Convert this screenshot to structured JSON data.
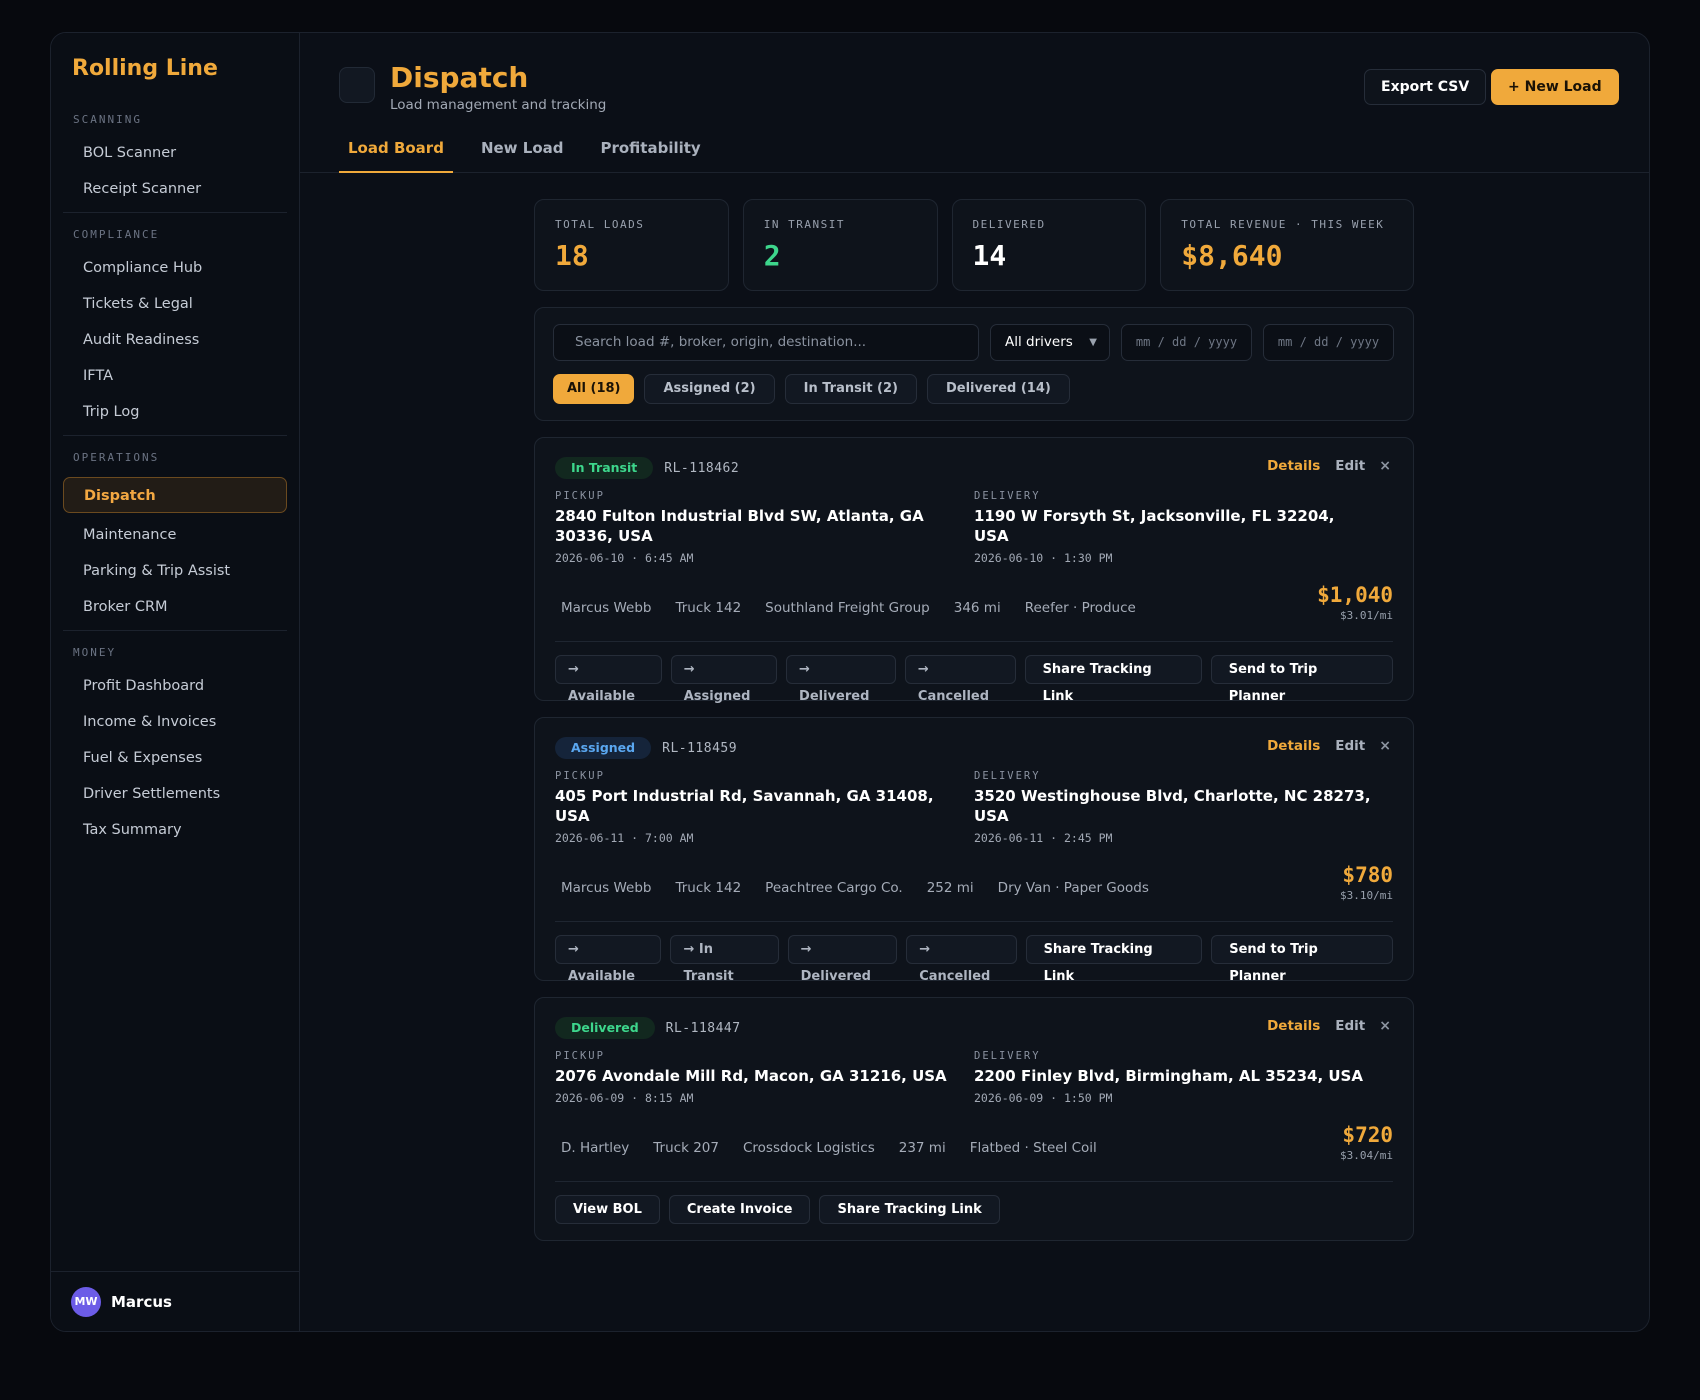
{
  "brand": "Rolling Line",
  "sidebar": {
    "sections": [
      {
        "label": "SCANNING",
        "items": [
          "BOL Scanner",
          "Receipt Scanner"
        ]
      },
      {
        "label": "COMPLIANCE",
        "items": [
          "Compliance Hub",
          "Tickets & Legal",
          "Audit Readiness",
          "IFTA",
          "Trip Log"
        ]
      },
      {
        "label": "OPERATIONS",
        "items": [
          "Dispatch",
          "Maintenance",
          "Parking & Trip Assist",
          "Broker CRM"
        ]
      },
      {
        "label": "MONEY",
        "items": [
          "Profit Dashboard",
          "Income & Invoices",
          "Fuel & Expenses",
          "Driver Settlements",
          "Tax Summary"
        ]
      }
    ],
    "active_item": "Dispatch",
    "user": {
      "initials": "MW",
      "name": "Marcus"
    }
  },
  "header": {
    "title": "Dispatch",
    "subtitle": "Load management and tracking",
    "export_label": "Export CSV",
    "new_load_label": "+ New Load",
    "tabs": [
      "Load Board",
      "New Load",
      "Profitability"
    ],
    "active_tab": "Load Board"
  },
  "stats": [
    {
      "label": "TOTAL LOADS",
      "value": "18",
      "color": "#f0a93b"
    },
    {
      "label": "IN TRANSIT",
      "value": "2",
      "color": "#3dd68c"
    },
    {
      "label": "DELIVERED",
      "value": "14",
      "color": "#ffffff"
    },
    {
      "label": "TOTAL REVENUE · THIS WEEK",
      "value": "$8,640",
      "color": "#f0a93b"
    }
  ],
  "filters": {
    "search_placeholder": "Search load #, broker, origin, destination...",
    "driver_select": "All drivers",
    "date_from_placeholder": "mm / dd / yyyy",
    "date_to_placeholder": "mm / dd / yyyy",
    "pills": [
      "All (18)",
      "Assigned (2)",
      "In Transit (2)",
      "Delivered (14)"
    ],
    "active_pill": "All (18)"
  },
  "loads": [
    {
      "status": "In Transit",
      "status_class": "transit",
      "id": "RL-118462",
      "details_label": "Details",
      "edit_label": "Edit",
      "close_icon": "×",
      "pickup_label": "PICKUP",
      "pickup_address": "2840 Fulton Industrial Blvd SW, Atlanta, GA 30336, USA",
      "pickup_time": "2026-06-10 · 6:45 AM",
      "delivery_label": "DELIVERY",
      "delivery_address": "1190 W Forsyth St, Jacksonville, FL 32204, USA",
      "delivery_time": "2026-06-10 · 1:30 PM",
      "meta": [
        "Marcus Webb",
        "Truck 142",
        "Southland Freight Group",
        "346 mi",
        "Reefer · Produce"
      ],
      "rate": "$1,040",
      "rate_per_mile": "$3.01/mi",
      "buttons": [
        {
          "label": "→ Available",
          "primary": false
        },
        {
          "label": "→ Assigned",
          "primary": false
        },
        {
          "label": "→ Delivered",
          "primary": false
        },
        {
          "label": "→ Cancelled",
          "primary": false
        },
        {
          "label": "Share Tracking Link",
          "primary": true
        },
        {
          "label": "Send to Trip Planner",
          "primary": true
        }
      ]
    },
    {
      "status": "Assigned",
      "status_class": "assigned",
      "id": "RL-118459",
      "details_label": "Details",
      "edit_label": "Edit",
      "close_icon": "×",
      "pickup_label": "PICKUP",
      "pickup_address": "405 Port Industrial Rd, Savannah, GA 31408, USA",
      "pickup_time": "2026-06-11 · 7:00 AM",
      "delivery_label": "DELIVERY",
      "delivery_address": "3520 Westinghouse Blvd, Charlotte, NC 28273, USA",
      "delivery_time": "2026-06-11 · 2:45 PM",
      "meta": [
        "Marcus Webb",
        "Truck 142",
        "Peachtree Cargo Co.",
        "252 mi",
        "Dry Van · Paper Goods"
      ],
      "rate": "$780",
      "rate_per_mile": "$3.10/mi",
      "buttons": [
        {
          "label": "→ Available",
          "primary": false
        },
        {
          "label": "→ In Transit",
          "primary": false
        },
        {
          "label": "→ Delivered",
          "primary": false
        },
        {
          "label": "→ Cancelled",
          "primary": false
        },
        {
          "label": "Share Tracking Link",
          "primary": true
        },
        {
          "label": "Send to Trip Planner",
          "primary": true
        }
      ]
    },
    {
      "status": "Delivered",
      "status_class": "delivered",
      "id": "RL-118447",
      "details_label": "Details",
      "edit_label": "Edit",
      "close_icon": "×",
      "pickup_label": "PICKUP",
      "pickup_address": "2076 Avondale Mill Rd, Macon, GA 31216, USA",
      "pickup_time": "2026-06-09 · 8:15 AM",
      "delivery_label": "DELIVERY",
      "delivery_address": "2200 Finley Blvd, Birmingham, AL 35234, USA",
      "delivery_time": "2026-06-09 · 1:50 PM",
      "meta": [
        "D. Hartley",
        "Truck 207",
        "Crossdock Logistics",
        "237 mi",
        "Flatbed · Steel Coil"
      ],
      "rate": "$720",
      "rate_per_mile": "$3.04/mi",
      "buttons": [
        {
          "label": "View BOL",
          "primary": true
        },
        {
          "label": "Create Invoice",
          "primary": true
        },
        {
          "label": "Share Tracking Link",
          "primary": true
        }
      ]
    }
  ]
}
